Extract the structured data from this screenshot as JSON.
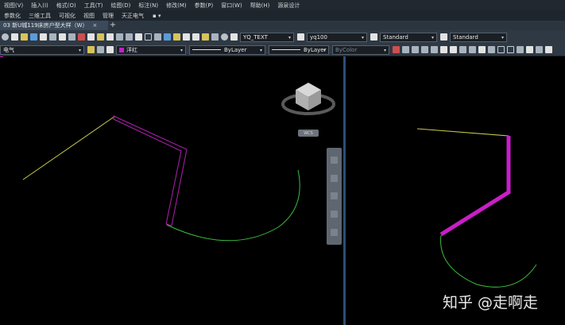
{
  "menu": [
    "视图(V)",
    "插入(I)",
    "格式(O)",
    "工具(T)",
    "绘图(D)",
    "标注(N)",
    "修改(M)",
    "参数(P)",
    "窗口(W)",
    "帮助(H)",
    "源泉设计"
  ],
  "ribbon_tabs": [
    "参数化",
    "三维工具",
    "可视化",
    "视图",
    "管理",
    "天正电气"
  ],
  "document": {
    "tab_title": "03 新U城119床房户型大样（W）",
    "close_glyph": "×",
    "new_tab_glyph": "+"
  },
  "toolbar1": {
    "text_style": "YQ_TEXT",
    "dim_style": "yq100",
    "table_style": "Standard",
    "multileader_style": "Standard"
  },
  "toolbar2": {
    "layer": "电气",
    "color": "洋红",
    "linetype": "ByLayer",
    "lineweight": "ByLayer",
    "plotstyle": "ByColor"
  },
  "viewcube": {
    "wcs_label": "WCS"
  },
  "watermark": "知乎 @走啊走",
  "colors": {
    "magenta": "#c81ec8",
    "yellow_line": "#c8c84a",
    "green_arc": "#3cbc3c",
    "divider": "#2c4f78"
  }
}
